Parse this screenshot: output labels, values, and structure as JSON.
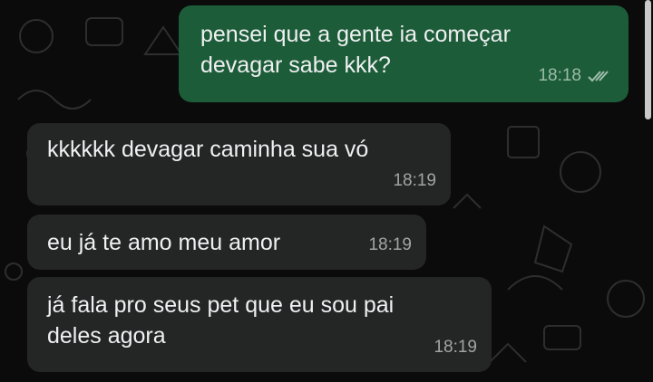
{
  "messages": [
    {
      "direction": "outgoing",
      "text": "pensei que a gente ia começar\ndevagar sabe kkk?",
      "time": "18:18",
      "status": "read-double-check"
    },
    {
      "direction": "incoming",
      "text": "kkkkkk devagar caminha sua vó",
      "time": "18:19"
    },
    {
      "direction": "incoming",
      "text": "eu já te amo meu amor",
      "time": "18:19"
    },
    {
      "direction": "incoming",
      "text": "já fala pro seus pet que eu sou pai\ndeles agora",
      "time": "18:19"
    }
  ],
  "colors": {
    "background": "#0b0b0b",
    "outgoing_bubble": "#1d5c39",
    "incoming_bubble": "#242626",
    "message_text": "#eef0f1"
  },
  "icons": [
    "double-check-icon",
    "chat-wallpaper-doodles"
  ]
}
